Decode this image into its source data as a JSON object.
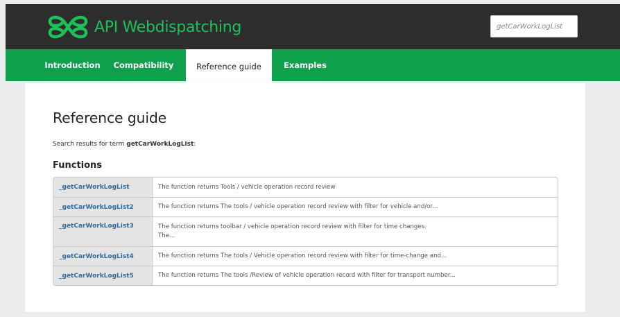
{
  "header": {
    "app_title": "API Webdispatching",
    "logo_icon": "infinity-links-logo-icon",
    "brand_color": "#1ec05a",
    "search": {
      "value": "getCarWorkLogList"
    }
  },
  "nav": {
    "tabs": [
      {
        "label": "Introduction",
        "active": false
      },
      {
        "label": "Compatibility",
        "active": false
      },
      {
        "label": "Reference guide",
        "active": true
      },
      {
        "label": "Examples",
        "active": false
      }
    ],
    "bg_color": "#0ea04b"
  },
  "main": {
    "title": "Reference guide",
    "search_prefix": "Search results for term ",
    "search_term": "getCarWorkLogList",
    "search_suffix": ":",
    "section_title": "Functions",
    "results": [
      {
        "name": "_getCarWorkLogList",
        "desc": "The function returns Tools / vehicle operation record review",
        "desc2": ""
      },
      {
        "name": "_getCarWorkLogList2",
        "desc": "The function returns The tools / vehicle operation record review with filter for vehicle and/or...",
        "desc2": ""
      },
      {
        "name": "_getCarWorkLogList3",
        "desc": "The function returns toolbar / vehicle operation record review with filter for time changes.",
        "desc2": "The..."
      },
      {
        "name": "_getCarWorkLogList4",
        "desc": "The function returns The tools / Vehicle operation record review with filter for time-change and...",
        "desc2": ""
      },
      {
        "name": "_getCarWorkLogList5",
        "desc": "The function returns The tools /Review of vehicle operation record with filter for transport number...",
        "desc2": ""
      }
    ]
  }
}
